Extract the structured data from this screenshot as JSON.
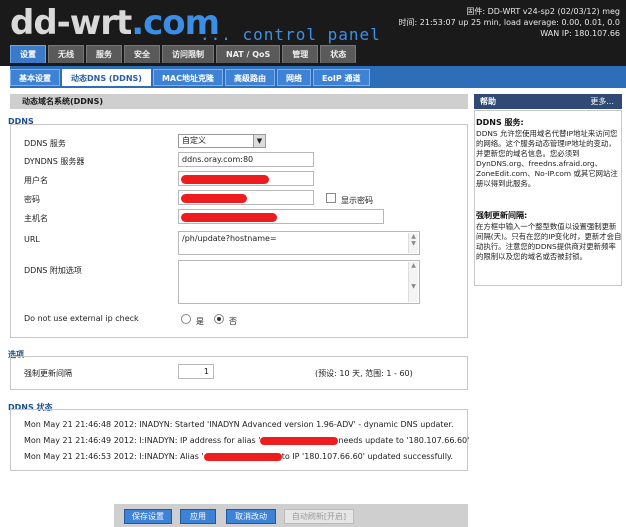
{
  "app": {
    "logo_main": "dd-wrt",
    "logo_dot": ".com",
    "logo_sub": "... control panel",
    "sysinfo": {
      "line1": "固件: DD-WRT v24-sp2 (02/03/12) meg",
      "line2": "时间: 21:53:07 up 25 min, load average: 0.00, 0.01, 0.0",
      "line3": "WAN IP: 180.107.66"
    }
  },
  "main_tabs": [
    {
      "label": "设置",
      "active": true
    },
    {
      "label": "无线",
      "active": false
    },
    {
      "label": "服务",
      "active": false
    },
    {
      "label": "安全",
      "active": false
    },
    {
      "label": "访问限制",
      "active": false
    },
    {
      "label": "NAT / QoS",
      "active": false
    },
    {
      "label": "管理",
      "active": false
    },
    {
      "label": "状态",
      "active": false
    }
  ],
  "sub_tabs": [
    {
      "label": "基本设置",
      "active": false
    },
    {
      "label": "动态DNS (DDNS)",
      "active": true
    },
    {
      "label": "MAC地址克隆",
      "active": false
    },
    {
      "label": "高级路由",
      "active": false
    },
    {
      "label": "网络",
      "active": false
    },
    {
      "label": "EoIP 通道",
      "active": false
    }
  ],
  "page_title": "动态域名系统(DDNS)",
  "ddns": {
    "section": "DDNS",
    "service_label": "DDNS 服务",
    "service_value": "自定义",
    "server_label": "DYNDNS 服务器",
    "server_value": "ddns.oray.com:80",
    "username_label": "用户名",
    "password_label": "密码",
    "show_password_label": "显示密码",
    "hostname_label": "主机名",
    "url_label": "URL",
    "url_value": "/ph/update?hostname=",
    "extra_label": "DDNS 附加选项",
    "extip_label": "Do not use external ip check",
    "extip_yes": "是",
    "extip_no": "否"
  },
  "options": {
    "section": "选项",
    "force_label": "强制更新间隔",
    "force_value": "1",
    "force_hint": "(预设: 10 天, 范围: 1 - 60)"
  },
  "status": {
    "section": "DDNS 状态",
    "lines": [
      {
        "a": "Mon May 21 21:46:48 2012: INADYN: Started 'INADYN Advanced version 1.96-ADV' - dynamic DNS updater.",
        "b": ""
      },
      {
        "a": "Mon May 21 21:46:49 2012: I:INADYN: IP address for alias '",
        "b": "needs update to '180.107.66.60'"
      },
      {
        "a": "Mon May 21 21:46:53 2012: I:INADYN: Alias '",
        "b": "to IP '180.107.66.60' updated successfully."
      }
    ]
  },
  "buttons": {
    "save": "保存设置",
    "apply": "应用",
    "cancel": "取消改动",
    "autorefresh": "自动刷新[开启]"
  },
  "help": {
    "header": "帮助",
    "more": "更多...",
    "ddns_title": "DDNS 服务:",
    "ddns_text": "DDNS 允许您使用域名代替IP地址来访问您的网络。这个服务动态管理IP地址的变动，并更新您的域名信息。您必须到 DynDNS.org、freedns.afraid.org、ZoneEdit.com、No-IP.com 或其它网站注册以得到此服务。",
    "force_title": "强制更新间隔:",
    "force_text": "在方框中输入一个整型数值以设置强制更新间隔(天)。只有在您的IP变化时，更新才会自动执行。注意您的DDNS提供商对更新频率的限制以及您的域名或否被封锁。"
  }
}
